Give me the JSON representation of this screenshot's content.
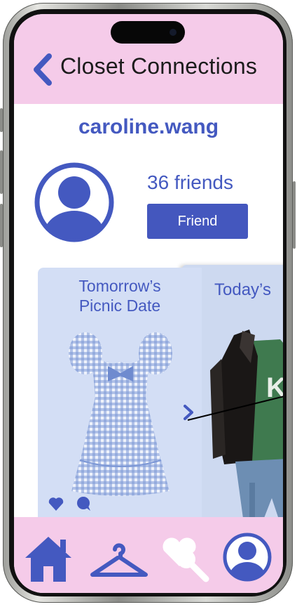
{
  "header": {
    "title": "Closet Connections",
    "back_icon": "chevron-left-icon"
  },
  "profile": {
    "username": "caroline.wang",
    "friends_count": "36 friends",
    "friend_button_label": "Friend",
    "avatar_icon": "user-avatar-icon"
  },
  "outfits": [
    {
      "title": "Tomorrow’s\nPicnic Date",
      "item": "gingham-dress-image",
      "actions": [
        "heart-icon",
        "comment-icon"
      ]
    },
    {
      "title": "Today’s",
      "item": "jacket-outfit-image"
    }
  ],
  "tabbar": {
    "items": [
      "home-icon",
      "hanger-icon",
      "heart-search-icon",
      "profile-icon"
    ]
  },
  "colors": {
    "accent": "#4459c0",
    "pink": "#f5cbe9",
    "card": "#d3def5",
    "button": "#4457be"
  }
}
